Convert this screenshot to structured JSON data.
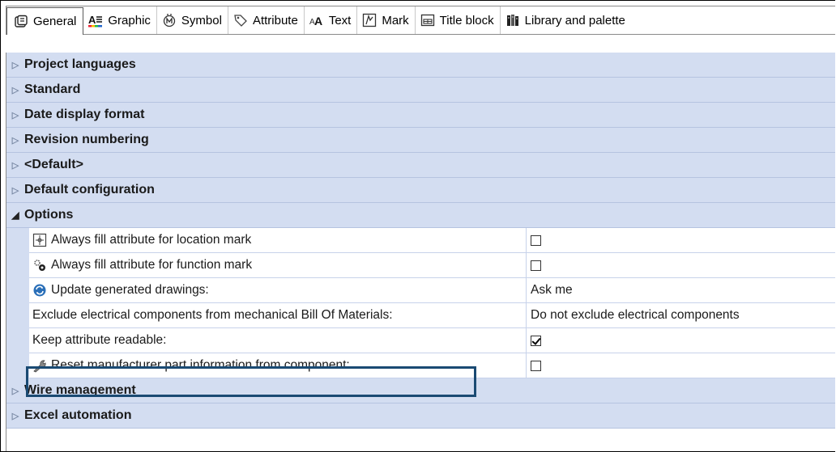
{
  "tabs": [
    {
      "label": "General",
      "icon": "general-icon",
      "active": true
    },
    {
      "label": "Graphic",
      "icon": "graphic-icon"
    },
    {
      "label": "Symbol",
      "icon": "symbol-icon"
    },
    {
      "label": "Attribute",
      "icon": "attribute-tag-icon"
    },
    {
      "label": "Text",
      "icon": "text-icon"
    },
    {
      "label": "Mark",
      "icon": "mark-icon"
    },
    {
      "label": "Title block",
      "icon": "title-block-icon"
    },
    {
      "label": "Library and palette",
      "icon": "library-icon"
    }
  ],
  "sections": [
    {
      "label": "Project languages",
      "expanded": false
    },
    {
      "label": "Standard",
      "expanded": false
    },
    {
      "label": "Date display format",
      "expanded": false
    },
    {
      "label": "Revision numbering",
      "expanded": false
    },
    {
      "label": "<Default>",
      "expanded": false
    },
    {
      "label": "Default configuration",
      "expanded": false
    },
    {
      "label": "Options",
      "expanded": true
    },
    {
      "label": "Wire management",
      "expanded": false
    },
    {
      "label": "Excel automation",
      "expanded": false
    }
  ],
  "options": [
    {
      "label": "Always fill attribute for location mark",
      "icon": "location-mark-icon",
      "value_type": "checkbox",
      "checked": false
    },
    {
      "label": "Always fill attribute for function mark",
      "icon": "gears-icon",
      "value_type": "checkbox",
      "checked": false
    },
    {
      "label": "Update generated drawings:",
      "icon": "refresh-icon",
      "value_type": "text",
      "value": "Ask me"
    },
    {
      "label": "Exclude electrical components from mechanical Bill Of Materials:",
      "icon": "",
      "value_type": "text",
      "value": "Do not exclude electrical components"
    },
    {
      "label": "Keep attribute readable:",
      "icon": "",
      "value_type": "checkbox",
      "checked": true
    },
    {
      "label": "Reset manufacturer part information from component:",
      "icon": "wrench-icon",
      "value_type": "checkbox",
      "checked": false
    }
  ],
  "colors": {
    "section_bg": "#d3ddf1",
    "highlight": "#1a4a73"
  }
}
